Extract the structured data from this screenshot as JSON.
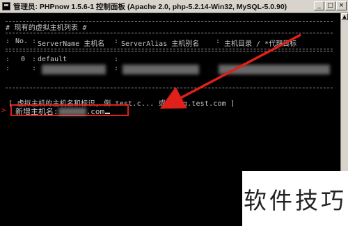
{
  "window": {
    "title": "管理员:  PHPnow 1.5.6-1 控制面板 (Apache 2.0, php-5.2.14-Win32, MySQL-5.0.90)",
    "minimize": "_",
    "maximize": "□",
    "close": "×"
  },
  "console": {
    "heading": "# 现有的虚拟主机列表 #",
    "columns": [
      "No.",
      "ServerName 主机名",
      "ServerAlias 主机别名",
      "主机目录 / *代理目标"
    ],
    "rows": [
      {
        "no": "0",
        "server_name": "default"
      }
    ],
    "hint": "[ 虚拟主机的主机名和标识, 例 test.c... 或 blog.test.com ]",
    "prompt_label": "新增主机名:",
    "prompt_value": ".com"
  },
  "annotation": {
    "color": "#e0201a"
  },
  "watermark": "软件技巧"
}
